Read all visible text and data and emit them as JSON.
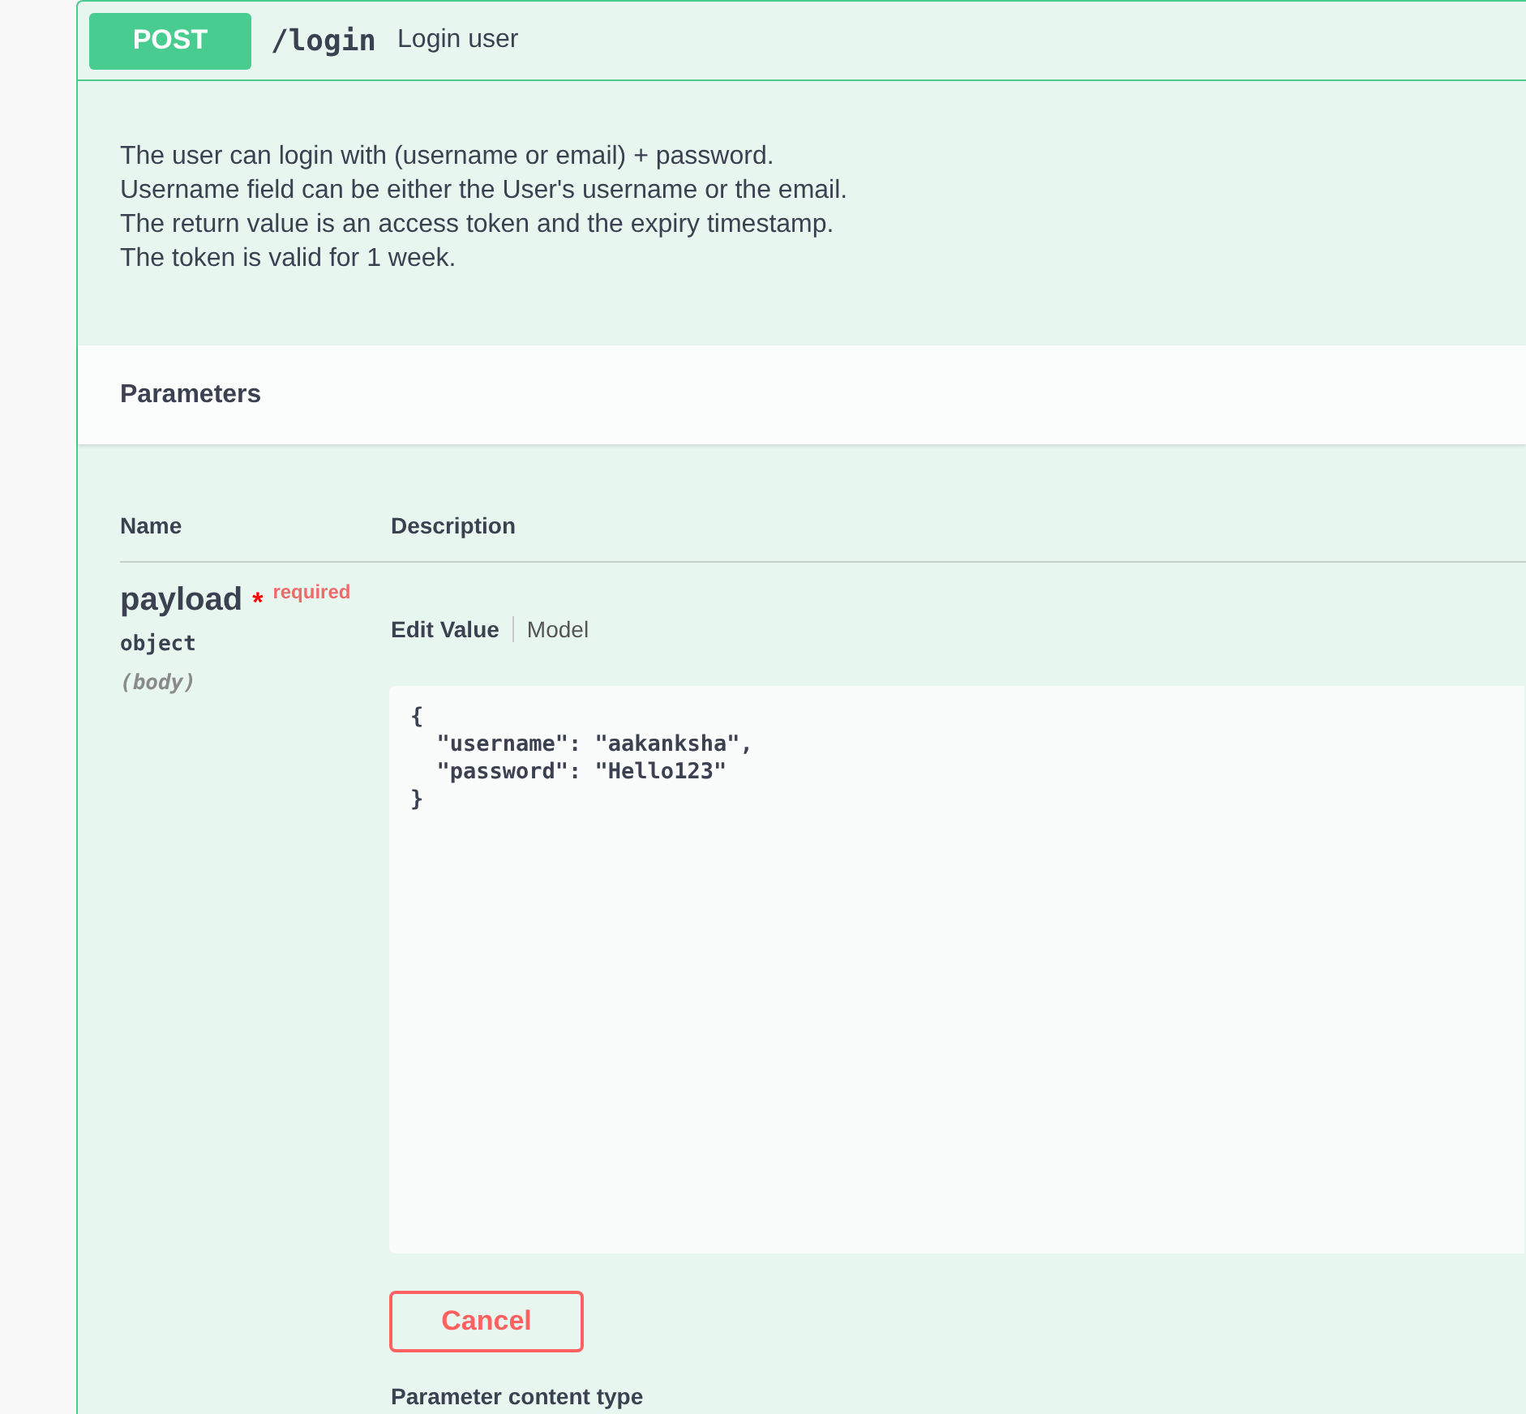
{
  "operation": {
    "method": "POST",
    "path": "/login",
    "summary": "Login user",
    "description": [
      "The user can login with (username or email) + password.",
      "Username field can be either the User's username or the email.",
      "The return value is an access token and the expiry timestamp.",
      "The token is valid for 1 week."
    ]
  },
  "parameters": {
    "title": "Parameters",
    "columns": [
      "Name",
      "Description"
    ],
    "items": [
      {
        "name": "payload",
        "required": true,
        "required_mark": "*",
        "required_label": "required",
        "type": "object",
        "location": "(body)",
        "tabs": [
          {
            "label": "Edit Value",
            "selected": true
          },
          {
            "label": "Model",
            "selected": false
          }
        ],
        "value": "{\n  \"username\": \"aakanksha\",\n  \"password\": \"Hello123\"\n}",
        "cancel_button": "Cancel",
        "content_type_label": "Parameter content type"
      }
    ]
  }
}
